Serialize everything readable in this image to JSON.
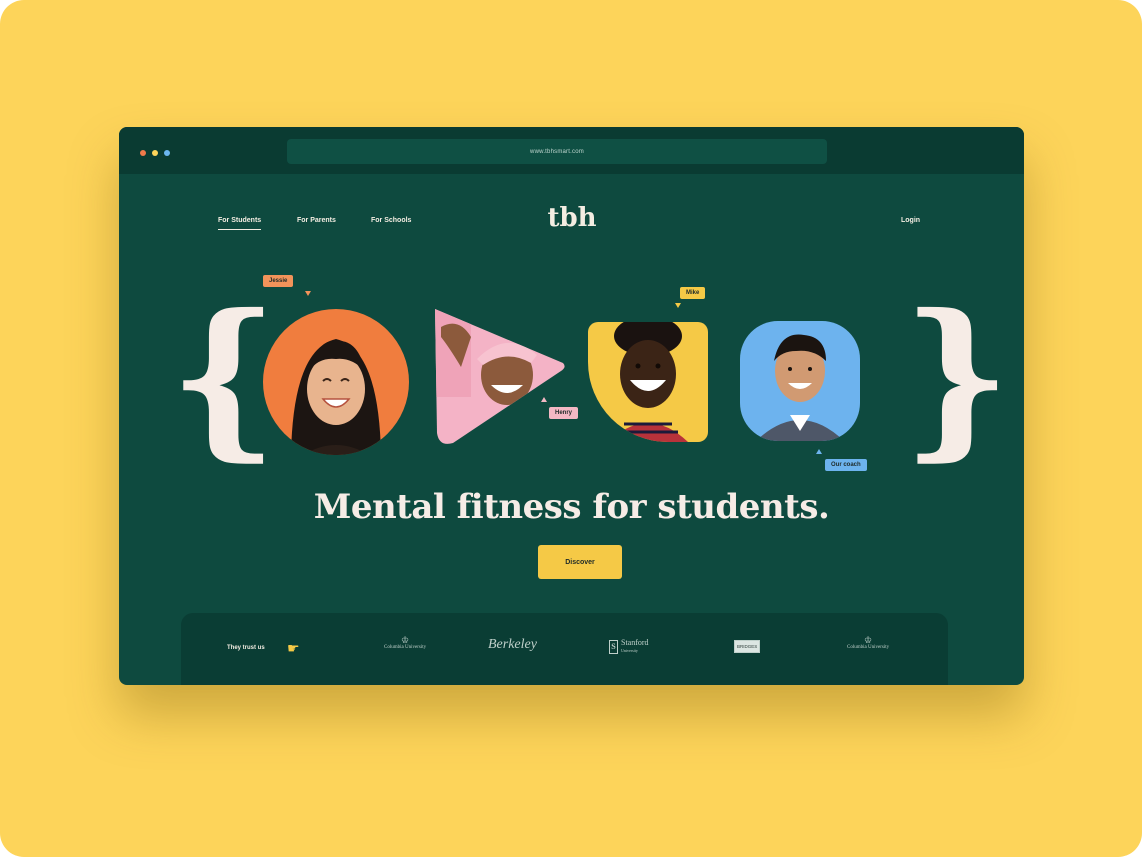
{
  "browser": {
    "url": "www.tbhsmart.com"
  },
  "nav": {
    "items": [
      {
        "label": "For Students"
      },
      {
        "label": "For Parents"
      },
      {
        "label": "For Schools"
      }
    ],
    "login_label": "Login"
  },
  "logo": {
    "text": "tbh"
  },
  "hero": {
    "tags": {
      "jessie": "Jessie",
      "mike": "Mike",
      "henry": "Henry",
      "coach": "Our coach"
    },
    "headline": "Mental fitness for students.",
    "cta_label": "Discover"
  },
  "trust": {
    "label": "They trust us",
    "partners": [
      {
        "name": "Columbia University",
        "crest": "♔"
      },
      {
        "name": "Berkeley"
      },
      {
        "name": "Stanford",
        "sub": "University",
        "mark": "S"
      },
      {
        "name": "BRIDGES"
      },
      {
        "name": "Columbia University",
        "crest": "♔"
      }
    ]
  },
  "colors": {
    "background": "#FDD45A",
    "page": "#0E4A3F",
    "accent": "#F5C946",
    "text": "#F6ECE6",
    "tag_orange": "#F2935A",
    "tag_yellow": "#F5C946",
    "tag_pink": "#F3B8C4",
    "tag_blue": "#6DB3EE"
  }
}
